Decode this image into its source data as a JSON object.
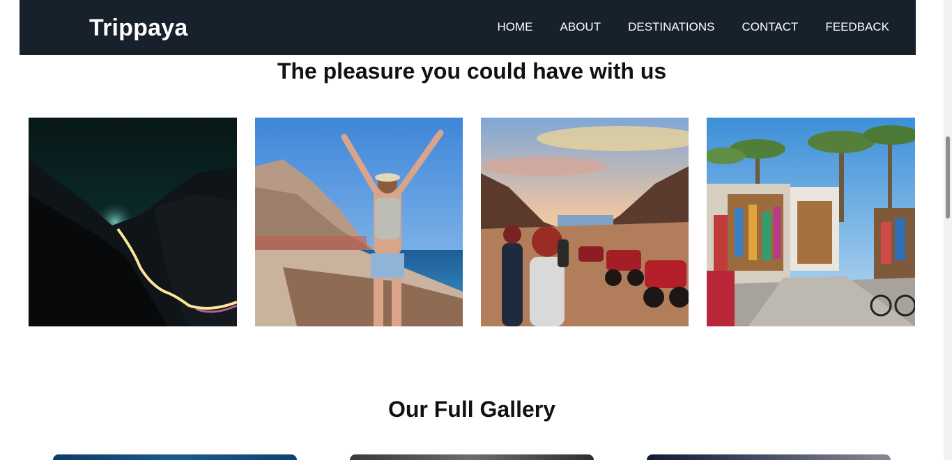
{
  "navbar": {
    "brand": "Trippaya",
    "links": [
      "HOME",
      "ABOUT",
      "DESTINATIONS",
      "CONTACT",
      "FEEDBACK"
    ]
  },
  "sections": {
    "pleasure_title": "The pleasure you could have with us",
    "gallery_title": "Our Full Gallery"
  },
  "colors": {
    "navbar_bg": "#17212b",
    "nav_text": "#ffffff"
  }
}
